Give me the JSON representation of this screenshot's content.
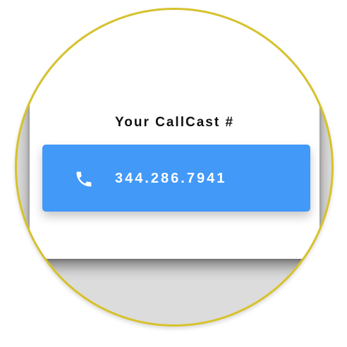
{
  "card": {
    "title": "Your CallCast #"
  },
  "phone_button": {
    "number": "344.286.7941",
    "icon": "phone-icon"
  },
  "colors": {
    "ring": "#d7c22a",
    "button": "#4299f7",
    "backdrop": "#dcdcdc",
    "card": "#ffffff"
  }
}
